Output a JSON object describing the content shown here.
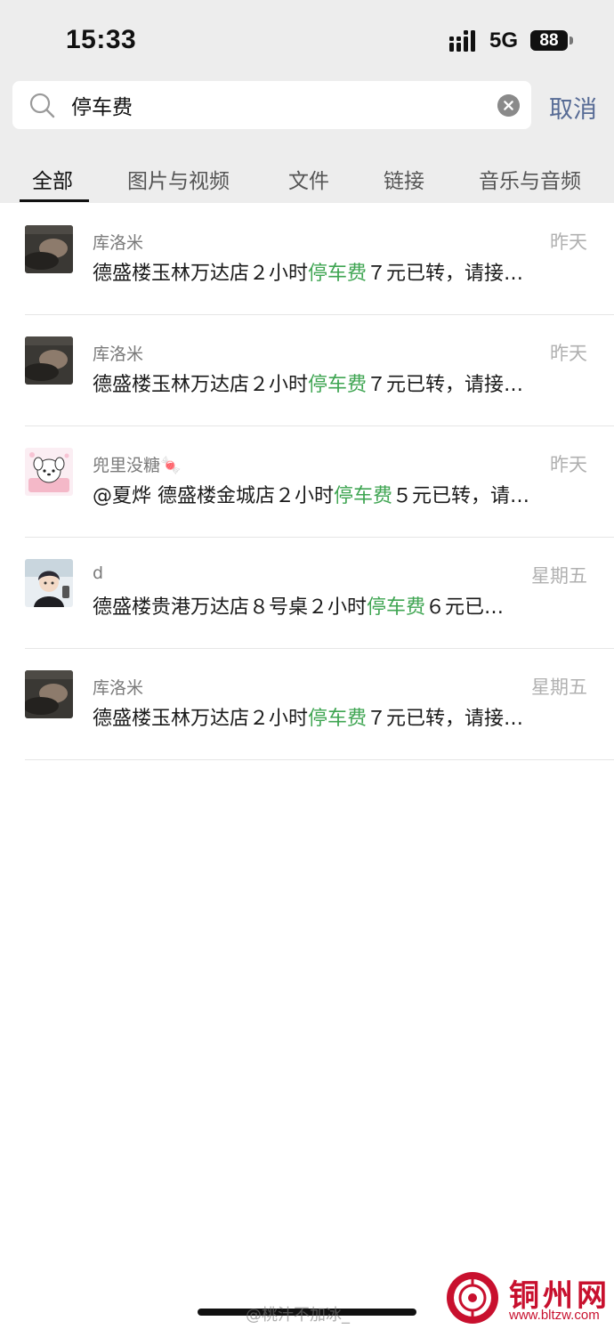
{
  "status_bar": {
    "time": "15:33",
    "network": "5G",
    "battery": "88"
  },
  "search": {
    "query": "停车费",
    "cancel_label": "取消"
  },
  "tabs": [
    {
      "label": "全部",
      "active": true
    },
    {
      "label": "图片与视频",
      "active": false
    },
    {
      "label": "文件",
      "active": false
    },
    {
      "label": "链接",
      "active": false
    },
    {
      "label": "音乐与音频",
      "active": false
    }
  ],
  "results": [
    {
      "name": "库洛米",
      "time": "昨天",
      "pre": "德盛楼玉林万达店２小时",
      "hl": "停车费",
      "post": "７元已转，请接…",
      "avatar": "photo-dark"
    },
    {
      "name": "库洛米",
      "time": "昨天",
      "pre": "德盛楼玉林万达店２小时",
      "hl": "停车费",
      "post": "７元已转，请接…",
      "avatar": "photo-dark"
    },
    {
      "name": "兜里没糖🍬",
      "time": "昨天",
      "pre": "@夏烨 德盛楼金城店２小时",
      "hl": "停车费",
      "post": "５元已转，请…",
      "avatar": "cartoon-dog"
    },
    {
      "name": "d",
      "time": "星期五",
      "pre": "德盛楼贵港万达店８号桌２小时",
      "hl": "停车费",
      "post": "６元已…",
      "avatar": "anime-boy"
    },
    {
      "name": "库洛米",
      "time": "星期五",
      "pre": "德盛楼玉林万达店２小时",
      "hl": "停车费",
      "post": "７元已转，请接…",
      "avatar": "photo-dark"
    }
  ],
  "watermarks": {
    "weibo": "@桃汁不加冰_",
    "site_name": "铜州网",
    "site_url": "www.bltzw.com"
  },
  "colors": {
    "highlight": "#3fa552",
    "cancel": "#576b95",
    "header_bg": "#ededed",
    "watermark_red": "#c8102e"
  }
}
